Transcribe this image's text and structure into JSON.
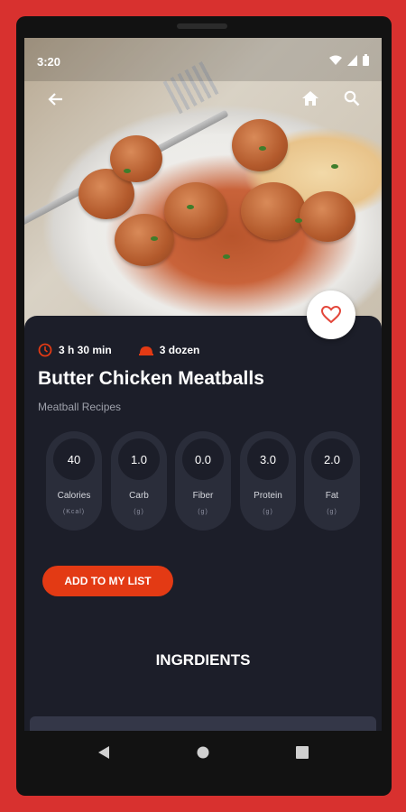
{
  "status": {
    "time": "3:20"
  },
  "icons": {
    "back": "arrow-back-icon",
    "home": "home-icon",
    "search": "search-icon",
    "favorite": "heart-outline-icon",
    "clock": "clock-icon",
    "servings": "dish-icon"
  },
  "recipe": {
    "time": "3 h 30 min",
    "servings": "3 dozen",
    "title": "Butter Chicken Meatballs",
    "category": "Meatball Recipes"
  },
  "nutrition": [
    {
      "value": "40",
      "label": "Calories",
      "unit": "(Kcal)"
    },
    {
      "value": "1.0",
      "label": "Carb",
      "unit": "(g)"
    },
    {
      "value": "0.0",
      "label": "Fiber",
      "unit": "(g)"
    },
    {
      "value": "3.0",
      "label": "Protein",
      "unit": "(g)"
    },
    {
      "value": "2.0",
      "label": "Fat",
      "unit": "(g)"
    }
  ],
  "actions": {
    "add_to_list": "ADD TO MY LIST"
  },
  "sections": {
    "ingredients_title": "INGRDIENTS"
  },
  "colors": {
    "background": "#d8312f",
    "card": "#1c1e29",
    "accent": "#e33a14",
    "pill": "#2a2d3a"
  }
}
